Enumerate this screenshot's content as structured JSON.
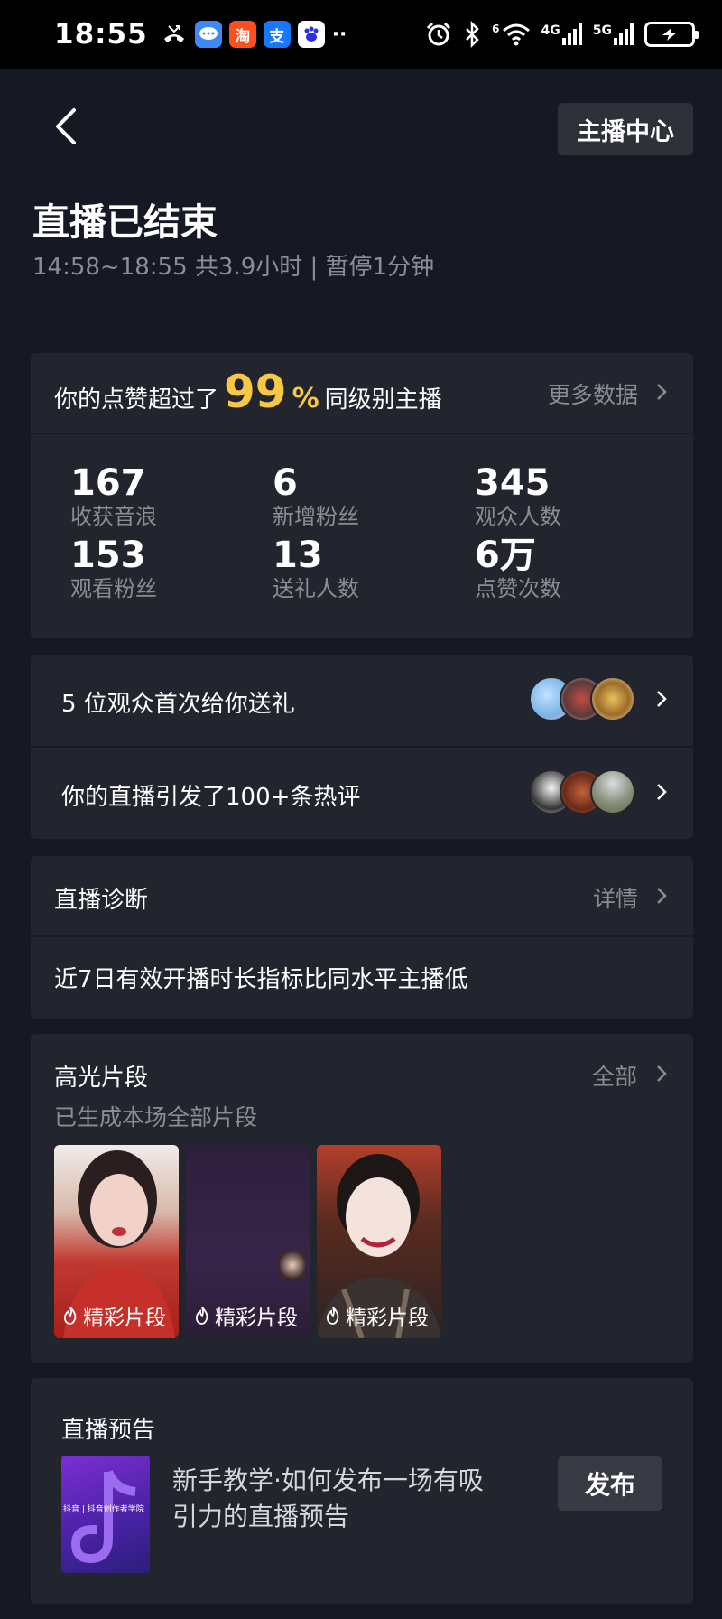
{
  "status_bar": {
    "time": "18:55",
    "network_a": "4G",
    "network_b": "5G",
    "wifi_badge": "6"
  },
  "header": {
    "anchor_center_label": "主播中心",
    "title": "直播已结束",
    "subtitle": "14:58~18:55 共3.9小时 | 暂停1分钟"
  },
  "likes_card": {
    "prefix": "你的点赞超过了",
    "percent_value": "99",
    "percent_symbol": "%",
    "suffix": "同级别主播",
    "more_label": "更多数据",
    "stats": [
      {
        "value": "167",
        "label": "收获音浪"
      },
      {
        "value": "6",
        "label": "新增粉丝"
      },
      {
        "value": "345",
        "label": "观众人数"
      },
      {
        "value": "153",
        "label": "观看粉丝"
      },
      {
        "value": "13",
        "label": "送礼人数"
      },
      {
        "value": "6万",
        "label": "点赞次数"
      }
    ]
  },
  "audience_card": {
    "gift_text": "5 位观众首次给你送礼",
    "comment_text": "你的直播引发了100+条热评"
  },
  "diagnosis_card": {
    "title": "直播诊断",
    "detail_label": "详情",
    "message": "近7日有效开播时长指标比同水平主播低"
  },
  "highlights_card": {
    "title": "高光片段",
    "all_label": "全部",
    "subtitle": "已生成本场全部片段",
    "clips": [
      {
        "caption": "精彩片段"
      },
      {
        "caption": "精彩片段"
      },
      {
        "caption": "精彩片段"
      }
    ]
  },
  "preview_card": {
    "title": "直播预告",
    "tutorial_text_line1": "新手教学·如何发布一场有吸",
    "tutorial_text_line2": "引力的直播预告",
    "thumb_caption": "抖音 | 抖音创作者学院",
    "publish_label": "发布"
  },
  "colors": {
    "background": "#161823",
    "card": "#22242e",
    "accent_yellow": "#f7c844",
    "muted_text": "#8b8d95"
  }
}
